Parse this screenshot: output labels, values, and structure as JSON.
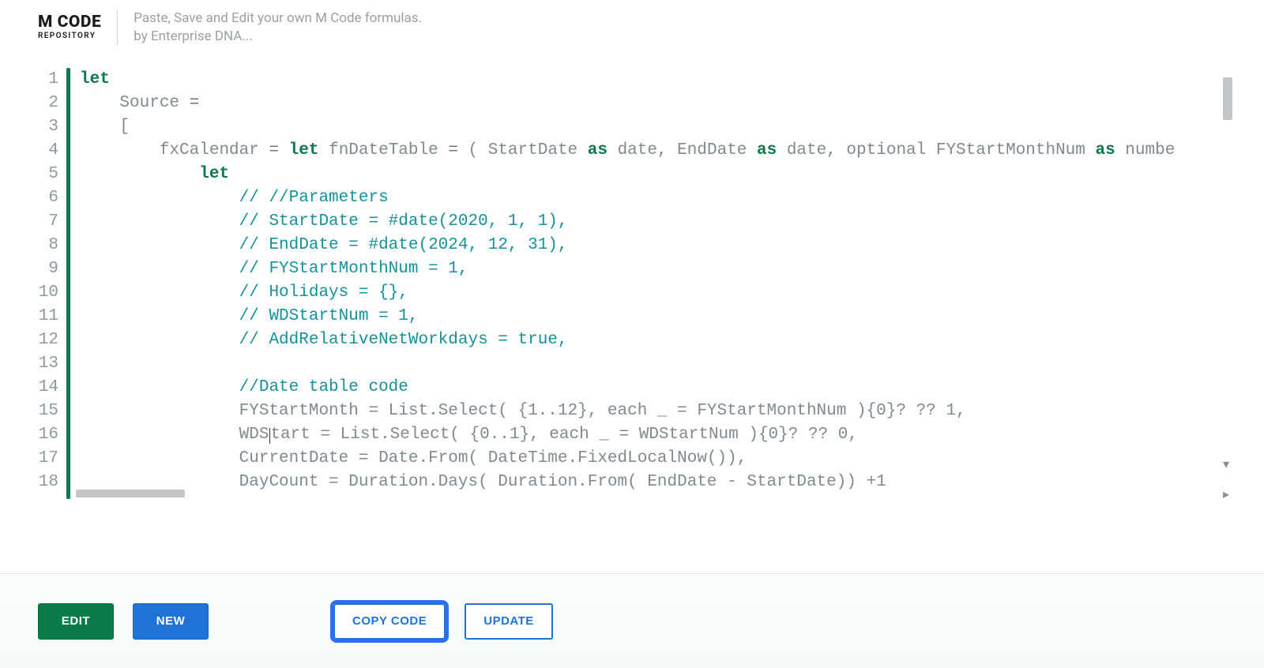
{
  "header": {
    "logo_top": "M CODE",
    "logo_sub": "REPOSITORY",
    "tagline_l1": "Paste, Save and Edit your own M Code formulas.",
    "tagline_l2": "by Enterprise DNA..."
  },
  "toolbar": {
    "edit": "EDIT",
    "new": "NEW",
    "copy": "COPY CODE",
    "update": "UPDATE"
  },
  "editor": {
    "line_numbers": [
      "1",
      "2",
      "3",
      "4",
      "5",
      "6",
      "7",
      "8",
      "9",
      "10",
      "11",
      "12",
      "13",
      "14",
      "15",
      "16",
      "17",
      "18"
    ],
    "lines": [
      {
        "indent": 0,
        "spans": [
          {
            "cls": "kw",
            "t": "let"
          }
        ]
      },
      {
        "indent": 1,
        "spans": [
          {
            "cls": "",
            "t": "Source "
          },
          {
            "cls": "op",
            "t": "="
          }
        ]
      },
      {
        "indent": 1,
        "spans": [
          {
            "cls": "",
            "t": "["
          }
        ]
      },
      {
        "indent": 2,
        "spans": [
          {
            "cls": "",
            "t": "fxCalendar "
          },
          {
            "cls": "op",
            "t": "="
          },
          {
            "cls": "",
            "t": " "
          },
          {
            "cls": "kw",
            "t": "let"
          },
          {
            "cls": "",
            "t": " fnDateTable "
          },
          {
            "cls": "op",
            "t": "="
          },
          {
            "cls": "",
            "t": " ( StartDate "
          },
          {
            "cls": "kw",
            "t": "as"
          },
          {
            "cls": "",
            "t": " date, EndDate "
          },
          {
            "cls": "kw",
            "t": "as"
          },
          {
            "cls": "",
            "t": " date, optional FYStartMonthNum "
          },
          {
            "cls": "kw",
            "t": "as"
          },
          {
            "cls": "",
            "t": " numbe"
          }
        ]
      },
      {
        "indent": 3,
        "spans": [
          {
            "cls": "kw",
            "t": "let"
          }
        ]
      },
      {
        "indent": 4,
        "spans": [
          {
            "cls": "cm",
            "t": "// //Parameters"
          }
        ]
      },
      {
        "indent": 4,
        "spans": [
          {
            "cls": "cm",
            "t": "// StartDate = #date(2020, 1, 1),"
          }
        ]
      },
      {
        "indent": 4,
        "spans": [
          {
            "cls": "cm",
            "t": "// EndDate = #date(2024, 12, 31),"
          }
        ]
      },
      {
        "indent": 4,
        "spans": [
          {
            "cls": "cm",
            "t": "// FYStartMonthNum = 1,"
          }
        ]
      },
      {
        "indent": 4,
        "spans": [
          {
            "cls": "cm",
            "t": "// Holidays = {},"
          }
        ]
      },
      {
        "indent": 4,
        "spans": [
          {
            "cls": "cm",
            "t": "// WDStartNum = 1,"
          }
        ]
      },
      {
        "indent": 4,
        "spans": [
          {
            "cls": "cm",
            "t": "// AddRelativeNetWorkdays = true,"
          }
        ]
      },
      {
        "indent": 4,
        "spans": [
          {
            "cls": "",
            "t": ""
          }
        ]
      },
      {
        "indent": 4,
        "spans": [
          {
            "cls": "cm",
            "t": "//Date table code"
          }
        ]
      },
      {
        "indent": 4,
        "spans": [
          {
            "cls": "",
            "t": "FYStartMonth = List.Select( {1..12}, each _ = FYStartMonthNum ){0}? ?? 1,"
          }
        ]
      },
      {
        "indent": 4,
        "spans": [
          {
            "cls": "",
            "t": "WDStart = List.Select( {0..1}, each _ = WDStartNum ){0}? ?? 0,"
          }
        ],
        "caret_after": 3
      },
      {
        "indent": 4,
        "spans": [
          {
            "cls": "",
            "t": "CurrentDate = Date.From( DateTime.FixedLocalNow()),"
          }
        ]
      },
      {
        "indent": 4,
        "spans": [
          {
            "cls": "",
            "t": "DayCount = Duration.Days( Duration.From( EndDate - StartDate)) +1"
          }
        ]
      }
    ]
  }
}
